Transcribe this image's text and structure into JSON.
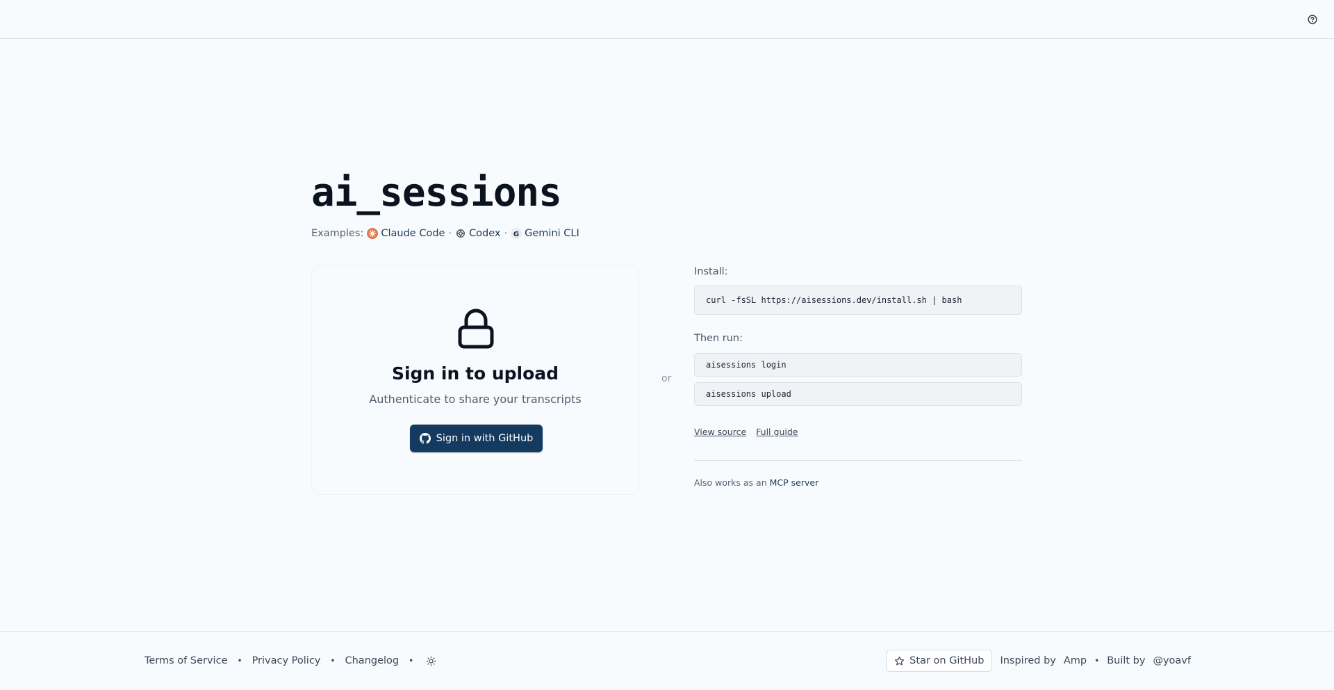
{
  "app": {
    "title": "ai_sessions"
  },
  "examples": {
    "label": "Examples:",
    "items": [
      {
        "label": "Claude Code",
        "icon": "claude-icon"
      },
      {
        "label": "Codex",
        "icon": "codex-icon"
      },
      {
        "label": "Gemini CLI",
        "icon": "gemini-icon"
      }
    ],
    "separator": "·"
  },
  "signin": {
    "icon": "lock-icon",
    "title": "Sign in to upload",
    "subtitle": "Authenticate to share your transcripts",
    "button_label": "Sign in with GitHub"
  },
  "or_label": "or",
  "install": {
    "label": "Install:",
    "command": "curl -fsSL https://aisessions.dev/install.sh | bash",
    "then_label": "Then run:",
    "commands": [
      "aisessions login",
      "aisessions upload"
    ],
    "view_source": "View source",
    "full_guide": "Full guide",
    "mcp_prefix": "Also works as an",
    "mcp_link": "MCP server"
  },
  "footer": {
    "terms": "Terms of Service",
    "privacy": "Privacy Policy",
    "changelog": "Changelog",
    "bullet": "•",
    "star": "Star on GitHub",
    "inspired_label": "Inspired by",
    "inspired_link": "Amp",
    "built_label": "Built by",
    "built_link": "@yoavf"
  },
  "colors": {
    "background": "#f8fbfd",
    "primary_button": "#143a60",
    "claude_accent": "#e07a52"
  }
}
